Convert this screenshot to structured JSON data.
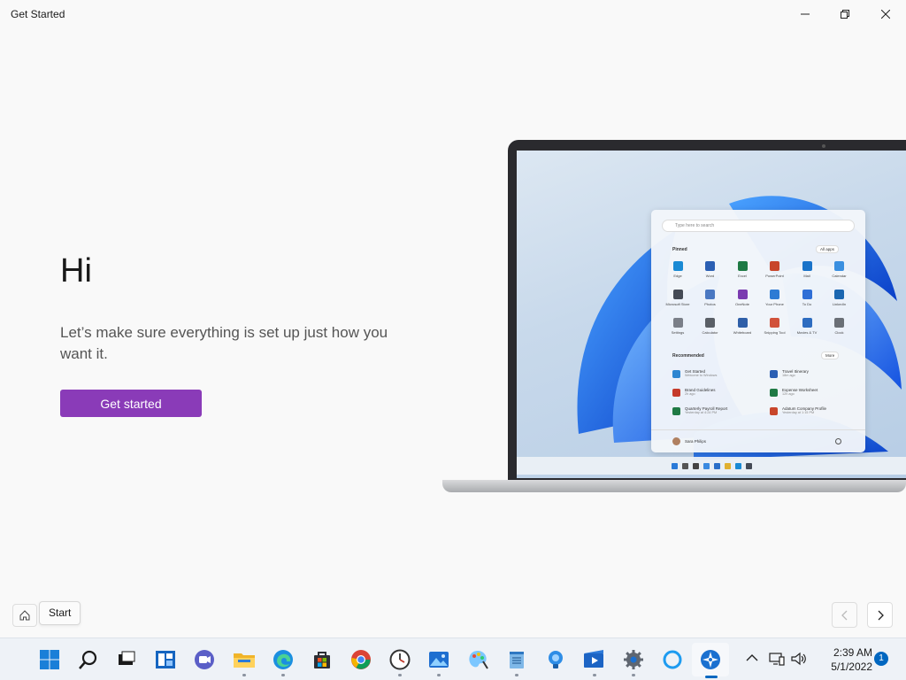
{
  "window": {
    "title": "Get Started"
  },
  "hero": {
    "heading": "Hi",
    "subtitle": "Let’s make sure everything is set up just how you want it.",
    "button_label": "Get started"
  },
  "illustration": {
    "start_menu": {
      "search_placeholder": "Type here to search",
      "pinned_label": "Pinned",
      "all_apps_label": "All apps",
      "recommended_label": "Recommended",
      "more_label": "More",
      "user_name": "Sara Philips",
      "pinned_apps": [
        {
          "name": "Edge",
          "color": "#1a8ad4"
        },
        {
          "name": "Word",
          "color": "#2b5fb3"
        },
        {
          "name": "Excel",
          "color": "#1f7a44"
        },
        {
          "name": "PowerPoint",
          "color": "#c8462b"
        },
        {
          "name": "Mail",
          "color": "#1a73c9"
        },
        {
          "name": "Calendar",
          "color": "#3a8fe0"
        },
        {
          "name": "Microsoft Store",
          "color": "#444a55"
        },
        {
          "name": "Photos",
          "color": "#4a78c2"
        },
        {
          "name": "OneNote",
          "color": "#7a3bb0"
        },
        {
          "name": "Your Phone",
          "color": "#2e7bd4"
        },
        {
          "name": "To Do",
          "color": "#2f6fd6"
        },
        {
          "name": "LinkedIn",
          "color": "#1a66b0"
        },
        {
          "name": "Settings",
          "color": "#7a7f88"
        },
        {
          "name": "Calculator",
          "color": "#5a5f66"
        },
        {
          "name": "Whiteboard",
          "color": "#2f5fa8"
        },
        {
          "name": "Snipping Tool",
          "color": "#d1523a"
        },
        {
          "name": "Movies & TV",
          "color": "#2d6cc0"
        },
        {
          "name": "Clock",
          "color": "#6a6f76"
        }
      ],
      "recommended": [
        {
          "title": "Get Started",
          "subtitle": "Welcome to Windows",
          "color": "#2e86d1"
        },
        {
          "title": "Travel Itinerary",
          "subtitle": "18m ago",
          "color": "#2b5fb3"
        },
        {
          "title": "Brand Guidelines",
          "subtitle": "2h ago",
          "color": "#c53a2a"
        },
        {
          "title": "Expense Worksheet",
          "subtitle": "12h ago",
          "color": "#1f7a44"
        },
        {
          "title": "Quarterly Payroll Report",
          "subtitle": "Yesterday at 4:24 PM",
          "color": "#1f7a44"
        },
        {
          "title": "Adatum Company Profile",
          "subtitle": "Yesterday at 1:15 PM",
          "color": "#c8462b"
        }
      ]
    }
  },
  "navigation": {
    "home_tooltip": "Start"
  },
  "taskbar": {
    "apps": [
      {
        "name": "Start",
        "icon": "windows-logo-icon"
      },
      {
        "name": "Search",
        "icon": "search-icon"
      },
      {
        "name": "Task View",
        "icon": "task-view-icon"
      },
      {
        "name": "Widgets",
        "icon": "widgets-icon"
      },
      {
        "name": "Chat",
        "icon": "chat-icon"
      },
      {
        "name": "File Explorer",
        "icon": "folder-icon"
      },
      {
        "name": "Microsoft Edge",
        "icon": "edge-icon"
      },
      {
        "name": "Microsoft Store",
        "icon": "store-icon"
      },
      {
        "name": "Google Chrome",
        "icon": "chrome-icon"
      },
      {
        "name": "Clock",
        "icon": "clock-icon"
      },
      {
        "name": "Photos",
        "icon": "photos-icon"
      },
      {
        "name": "Paint",
        "icon": "paint-icon"
      },
      {
        "name": "Notepad",
        "icon": "notepad-icon"
      },
      {
        "name": "Tips",
        "icon": "tips-icon"
      },
      {
        "name": "Movies & TV",
        "icon": "movies-icon"
      },
      {
        "name": "Settings",
        "icon": "gear-icon"
      },
      {
        "name": "Cortana",
        "icon": "cortana-icon"
      },
      {
        "name": "Get Started",
        "icon": "get-started-icon"
      }
    ],
    "time": "2:39 AM",
    "date": "5/1/2022",
    "notification_count": "1"
  }
}
